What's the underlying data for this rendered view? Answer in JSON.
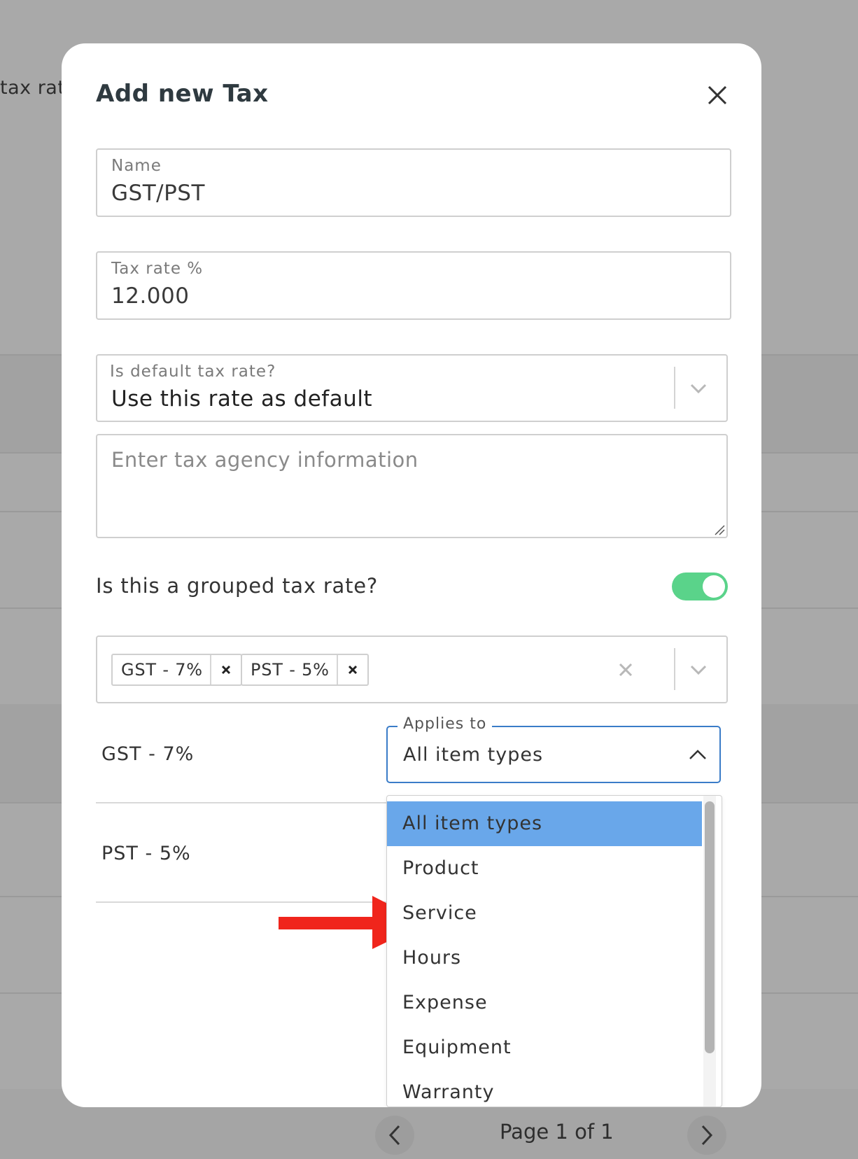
{
  "background": {
    "header_text": "tax rat",
    "pagination": {
      "prev_icon": "chevron-left-icon",
      "text": "Page 1 of 1",
      "next_icon": "chevron-right-icon"
    }
  },
  "modal": {
    "title": "Add new Tax",
    "close_icon": "close-icon",
    "name_field": {
      "label": "Name",
      "value": "GST/PST"
    },
    "tax_rate_field": {
      "label": "Tax rate %",
      "value": "12.000"
    },
    "default_select": {
      "label": "Is default tax rate?",
      "value": "Use this rate as default"
    },
    "agency_textarea": {
      "placeholder": "Enter tax agency information"
    },
    "grouped_toggle": {
      "label": "Is this a grouped tax rate?",
      "on": true
    },
    "grouped_rates": {
      "chips": [
        "GST - 7%",
        "PST - 5%"
      ]
    },
    "rows": [
      {
        "label": "GST - 7%",
        "applies_label": "Applies to",
        "applies_value": "All item types"
      },
      {
        "label": "PST - 5%"
      }
    ],
    "applies_dropdown": {
      "options": [
        "All item types",
        "Product",
        "Service",
        "Hours",
        "Expense",
        "Equipment",
        "Warranty"
      ],
      "selected": "All item types"
    }
  },
  "colors": {
    "accent_blue": "#3a7cc8",
    "selected_option": "#69a7ea",
    "toggle_on": "#5ad38a",
    "arrow_red": "#f0251c"
  }
}
